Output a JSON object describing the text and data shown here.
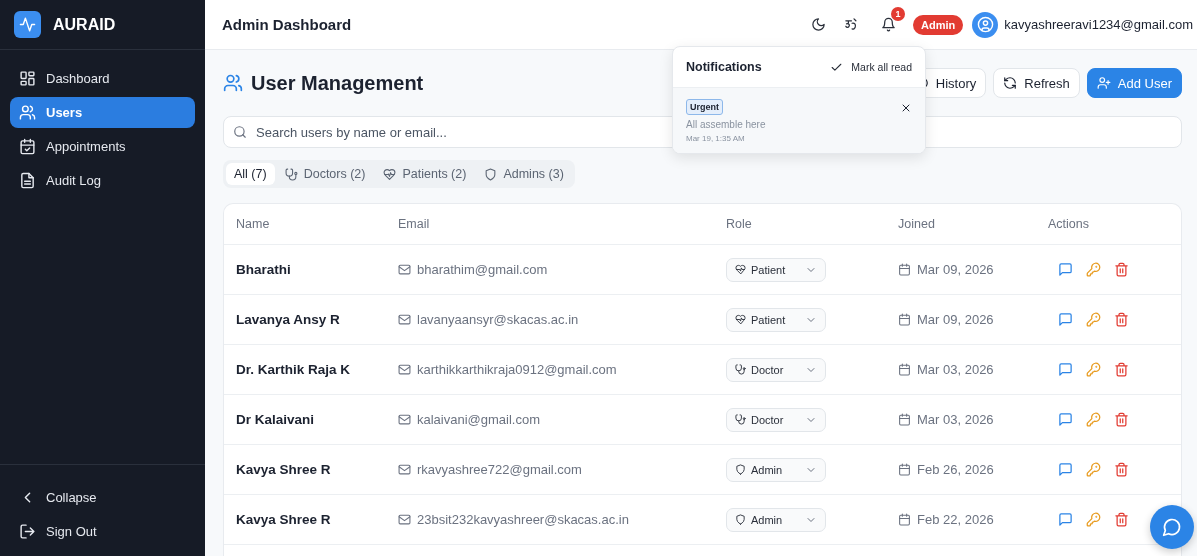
{
  "app": {
    "name": "AURAID"
  },
  "sidebar": {
    "items": [
      {
        "label": "Dashboard",
        "kind": "grid",
        "selected": false
      },
      {
        "label": "Users",
        "kind": "users",
        "selected": true
      },
      {
        "label": "Appointments",
        "kind": "calendar",
        "selected": false
      },
      {
        "label": "Audit Log",
        "kind": "file",
        "selected": false
      }
    ],
    "footer": [
      {
        "label": "Collapse",
        "kind": "collapse"
      },
      {
        "label": "Sign Out",
        "kind": "sign_out"
      }
    ]
  },
  "header": {
    "title": "Admin Dashboard",
    "notification_count": "1",
    "role_badge": "Admin",
    "user_email": "kavyashreeravi1234@gmail.com"
  },
  "notifications": {
    "title": "Notifications",
    "mark_all": "Mark all read",
    "items": [
      {
        "tag": "Urgent",
        "message": "All assemble here",
        "time": "Mar 19, 1:35 AM"
      }
    ]
  },
  "page": {
    "title": "User Management",
    "buttons": [
      {
        "label": "History",
        "kind": "history"
      },
      {
        "label": "Refresh",
        "kind": "refresh"
      },
      {
        "label": "Add User",
        "kind": "add"
      }
    ],
    "search": {
      "placeholder": "Search users by name or email..."
    },
    "filters": [
      {
        "label": "All (7)",
        "kind": "all",
        "selected": true
      },
      {
        "label": "Doctors (2)",
        "kind": "doctor",
        "selected": false
      },
      {
        "label": "Patients (2)",
        "kind": "patient",
        "selected": false
      },
      {
        "label": "Admins (3)",
        "kind": "admin",
        "selected": false
      }
    ]
  },
  "table": {
    "columns": [
      "Name",
      "Email",
      "Role",
      "Joined",
      "Actions"
    ],
    "rows": [
      {
        "name": "Bharathi",
        "email": "bharathim@gmail.com",
        "role": {
          "label": "Patient",
          "kind": "patient"
        },
        "joined": "Mar 09, 2026"
      },
      {
        "name": "Lavanya Ansy R",
        "email": "lavanyaansyr@skacas.ac.in",
        "role": {
          "label": "Patient",
          "kind": "patient"
        },
        "joined": "Mar 09, 2026"
      },
      {
        "name": "Dr. Karthik Raja K",
        "email": "karthikkarthikraja0912@gmail.com",
        "role": {
          "label": "Doctor",
          "kind": "doctor"
        },
        "joined": "Mar 03, 2026"
      },
      {
        "name": "Dr Kalaivani",
        "email": "kalaivani@gmail.com",
        "role": {
          "label": "Doctor",
          "kind": "doctor"
        },
        "joined": "Mar 03, 2026"
      },
      {
        "name": "Kavya Shree R",
        "email": "rkavyashree722@gmail.com",
        "role": {
          "label": "Admin",
          "kind": "admin"
        },
        "joined": "Feb 26, 2026"
      },
      {
        "name": "Kavya Shree R",
        "email": "23bsit232kavyashreer@skacas.ac.in",
        "role": {
          "label": "Admin",
          "kind": "admin"
        },
        "joined": "Feb 22, 2026"
      }
    ]
  }
}
